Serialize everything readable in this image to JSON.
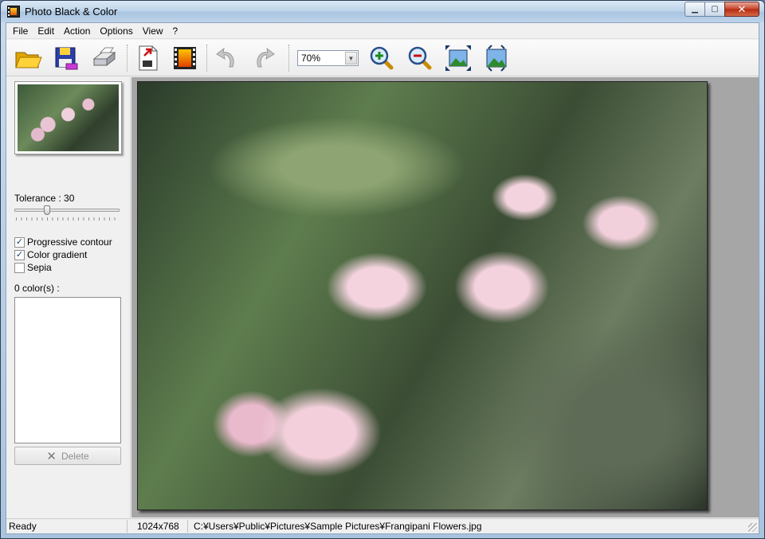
{
  "window": {
    "title": "Photo Black & Color",
    "icon": "film-strip-icon"
  },
  "menu": {
    "items": [
      {
        "label": "File"
      },
      {
        "label": "Edit"
      },
      {
        "label": "Action"
      },
      {
        "label": "Options"
      },
      {
        "label": "View"
      },
      {
        "label": "?"
      }
    ]
  },
  "toolbar": {
    "buttons": [
      {
        "name": "open-folder-icon"
      },
      {
        "name": "save-icon"
      },
      {
        "name": "print-icon"
      },
      {
        "name": "export-icon"
      },
      {
        "name": "filmstrip-icon"
      },
      {
        "name": "undo-icon"
      },
      {
        "name": "redo-icon"
      },
      {
        "name": "zoom-in-icon"
      },
      {
        "name": "zoom-out-icon"
      },
      {
        "name": "fit-to-window-icon"
      },
      {
        "name": "actual-size-icon"
      }
    ],
    "zoom_value": "70%"
  },
  "panel": {
    "tolerance_label": "Tolerance : 30",
    "tolerance_value": 30,
    "tolerance_max": 100,
    "options": [
      {
        "label": "Progressive contour",
        "checked": true
      },
      {
        "label": "Color gradient",
        "checked": true
      },
      {
        "label": "Sepia",
        "checked": false
      }
    ],
    "colors_label": "0 color(s) :",
    "delete_label": "Delete"
  },
  "status": {
    "state": "Ready",
    "dimensions": "1024x768",
    "path": "C:¥Users¥Public¥Pictures¥Sample Pictures¥Frangipani Flowers.jpg"
  },
  "colors": {
    "titlebar": "#bcd3e9",
    "close_button": "#c7432b",
    "viewport_bg": "#a6a6a6"
  }
}
